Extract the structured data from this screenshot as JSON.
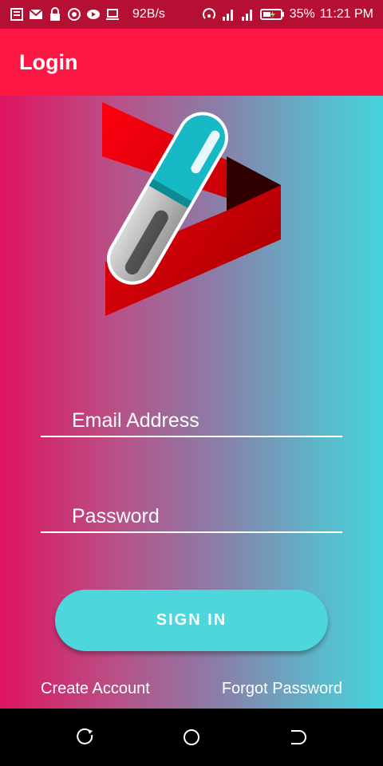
{
  "status_bar": {
    "network_speed": "92B/s",
    "battery": "35%",
    "time": "11:21 PM",
    "icons": [
      "news-icon",
      "gmail-icon",
      "lock-icon",
      "target-icon",
      "video-icon",
      "laptop-icon",
      "hotspot-icon",
      "signal-icon",
      "signal-icon",
      "battery-icon"
    ]
  },
  "app_bar": {
    "title": "Login"
  },
  "login_form": {
    "email_placeholder": "Email Address",
    "password_placeholder": "Password",
    "signin_label": "SIGN IN",
    "create_account_label": "Create Account",
    "forgot_password_label": "Forgot Password"
  },
  "colors": {
    "status_bar": "#b51034",
    "app_bar": "#ff1744",
    "gradient_start": "#de1460",
    "gradient_end": "#45d4dc",
    "button": "#4dd6dc"
  },
  "nav_bar": {
    "icons": [
      "recent-apps-icon",
      "home-icon",
      "back-icon"
    ]
  }
}
